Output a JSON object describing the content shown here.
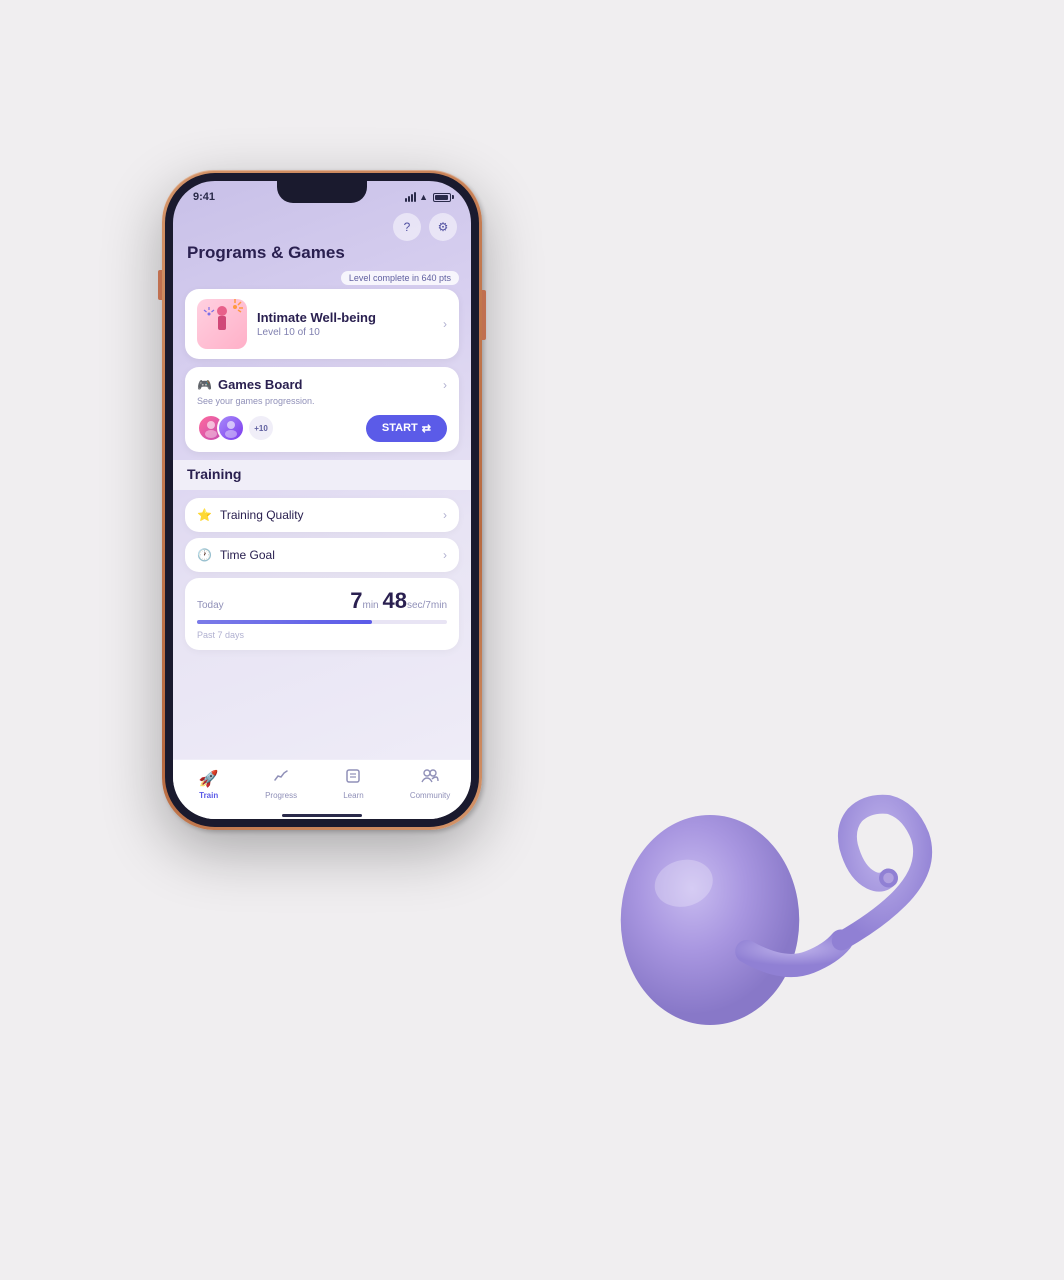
{
  "background_color": "#f0eef0",
  "status_bar": {
    "time": "9:41",
    "battery_level": 80
  },
  "top_icons": {
    "help_icon": "?",
    "settings_icon": "⚙"
  },
  "page_title": "Programs & Games",
  "level_badge": {
    "text": "Level complete in 640 pts"
  },
  "wellbeing_card": {
    "title": "Intimate Well-being",
    "subtitle": "Level 10 of 10",
    "emoji": "🎆"
  },
  "games_card": {
    "title": "Games Board",
    "subtitle": "See your games progression.",
    "avatar_plus": "+10",
    "start_button": "START"
  },
  "training_section": {
    "label": "Training",
    "items": [
      {
        "icon": "⭐",
        "label": "Training Quality"
      },
      {
        "icon": "🕐",
        "label": "Time Goal"
      }
    ]
  },
  "today_stats": {
    "label": "Today",
    "minutes": "7",
    "min_unit": "min",
    "seconds": "48",
    "sec_unit": "sec/7min",
    "progress_percent": 70,
    "past_days_label": "Past 7 days"
  },
  "bottom_nav": {
    "items": [
      {
        "icon": "🚀",
        "label": "Train",
        "active": true
      },
      {
        "icon": "📈",
        "label": "Progress",
        "active": false
      },
      {
        "icon": "📖",
        "label": "Learn",
        "active": false
      },
      {
        "icon": "👥",
        "label": "Community",
        "active": false
      }
    ]
  }
}
